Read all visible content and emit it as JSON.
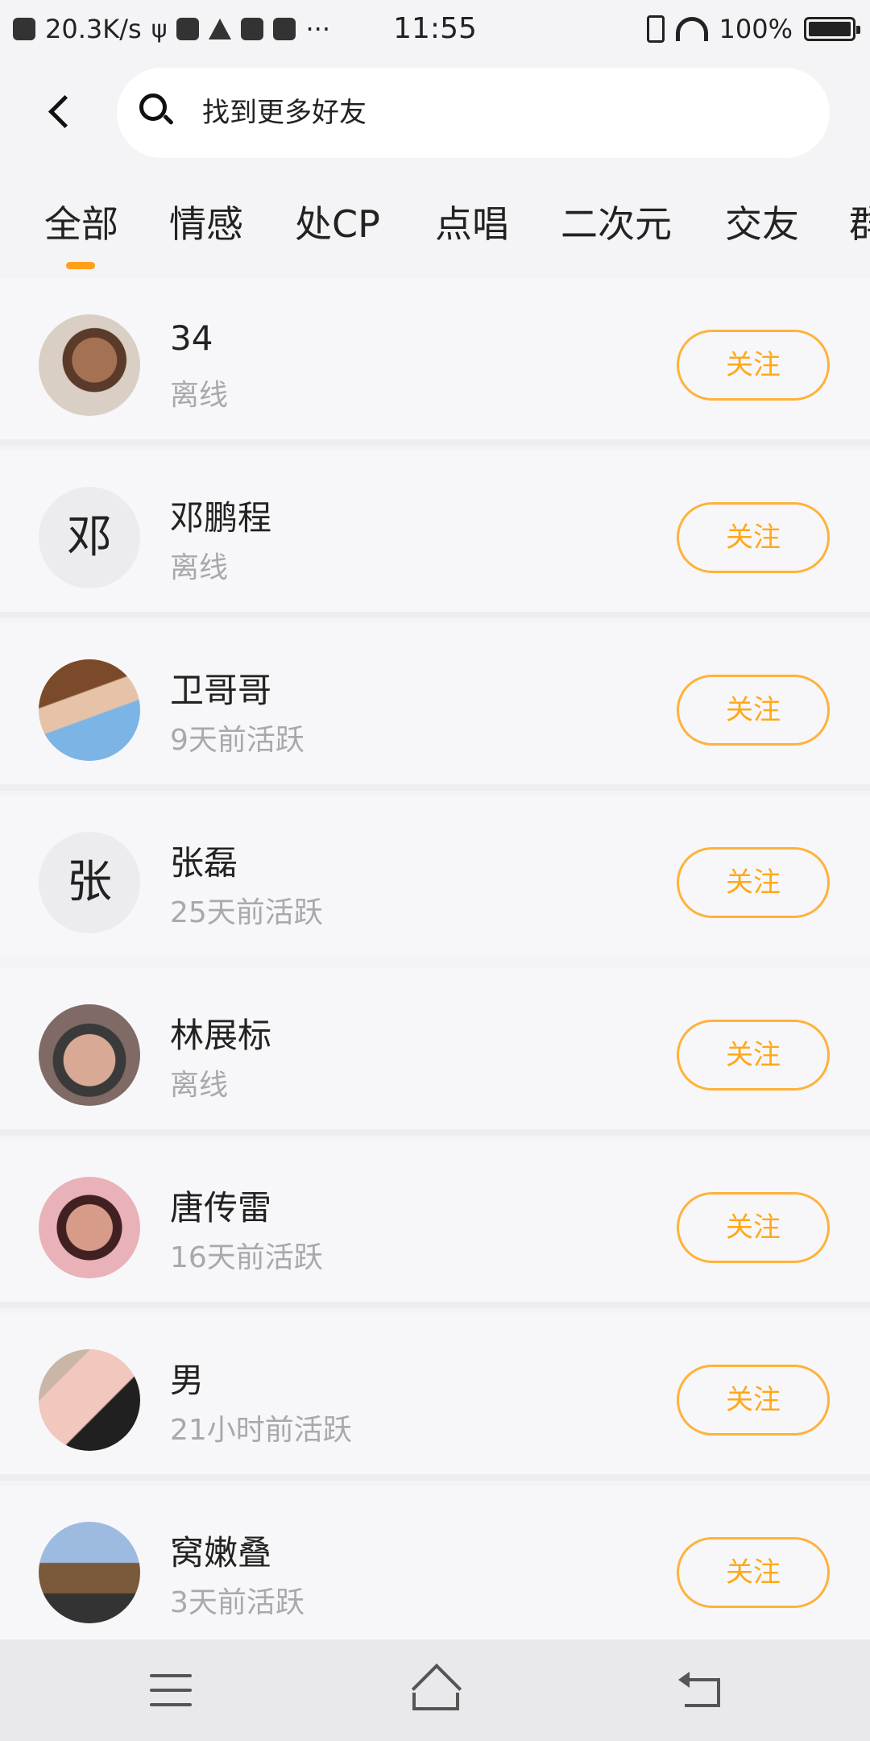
{
  "status_bar": {
    "network_speed": "20.3K/s",
    "time": "11:55",
    "battery": "100%",
    "more": "···"
  },
  "search": {
    "placeholder": "找到更多好友"
  },
  "tabs": [
    {
      "label": "全部",
      "active": true
    },
    {
      "label": "情感"
    },
    {
      "label": "处CP"
    },
    {
      "label": "点唱"
    },
    {
      "label": "二次元"
    },
    {
      "label": "交友"
    },
    {
      "label": "群"
    }
  ],
  "users": [
    {
      "name": "34",
      "status": "离线",
      "avatar_letter": "",
      "follow_label": "关注"
    },
    {
      "name": "邓鹏程",
      "status": "离线",
      "avatar_letter": "邓",
      "follow_label": "关注"
    },
    {
      "name": "卫哥哥",
      "status": "9天前活跃",
      "avatar_letter": "",
      "follow_label": "关注"
    },
    {
      "name": "张磊",
      "status": "25天前活跃",
      "avatar_letter": "张",
      "follow_label": "关注"
    },
    {
      "name": "林展标",
      "status": "离线",
      "avatar_letter": "",
      "follow_label": "关注"
    },
    {
      "name": "唐传雷",
      "status": "16天前活跃",
      "avatar_letter": "",
      "follow_label": "关注"
    },
    {
      "name": "男",
      "status": "21小时前活跃",
      "avatar_letter": "",
      "follow_label": "关注"
    },
    {
      "name": "窝嫩叠",
      "status": "3天前活跃",
      "avatar_letter": "",
      "follow_label": "关注"
    }
  ],
  "colors": {
    "accent": "#ffa81a",
    "background": "#f4f4f6",
    "muted_text": "#a8a8ad"
  }
}
